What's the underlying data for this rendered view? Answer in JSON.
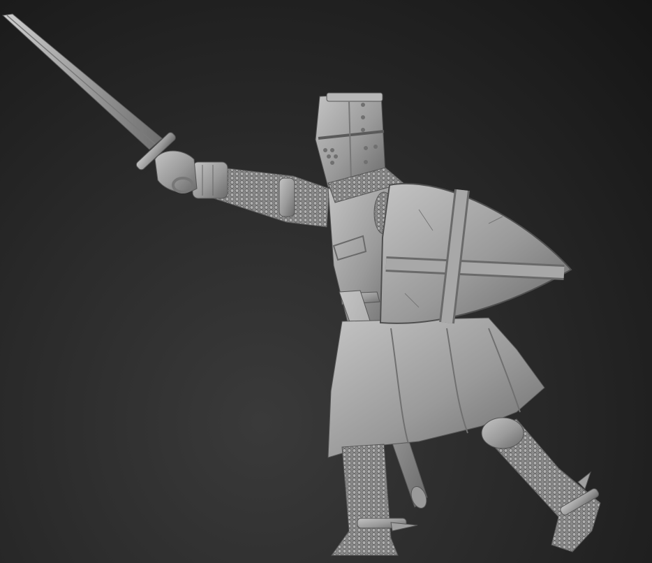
{
  "scene": {
    "subject": "knight-sculpt",
    "colors": {
      "background_top": "#141414",
      "background_bottom": "#3a3a3a",
      "clay_light": "#b9b9b9",
      "clay_mid": "#8f8f8f",
      "clay_dark": "#5a5a5a"
    },
    "icons": [
      "sword-icon",
      "shield-icon",
      "helmet-icon"
    ]
  }
}
